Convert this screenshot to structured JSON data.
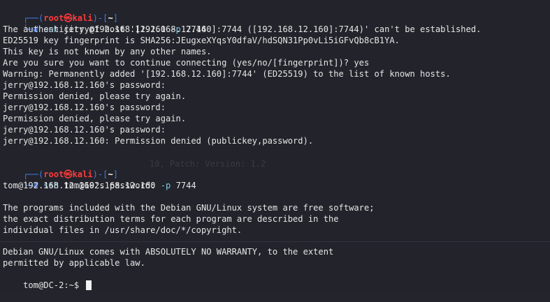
{
  "prompt1": {
    "bracket_open": "┌──(",
    "user": "root",
    "at_symbol": "㉿",
    "host": "kali",
    "bracket_mid": ")-[",
    "path": "~",
    "bracket_close": "]",
    "arrow": "└─",
    "hash": "#",
    "cmd": "ssh",
    "args": "jerry@192.168.12.160",
    "flag": "-p",
    "port": "7744"
  },
  "output1": [
    "The authenticity of host '[192.168.12.160]:7744 ([192.168.12.160]:7744)' can't be established.",
    "ED25519 key fingerprint is SHA256:JEugxeXYqsY0dfaV/hdSQN31Pp0vLi5iGFvQb8cB1YA.",
    "This key is not known by any other names.",
    "Are you sure you want to continue connecting (yes/no/[fingerprint])? yes",
    "Warning: Permanently added '[192.168.12.160]:7744' (ED25519) to the list of known hosts.",
    "jerry@192.168.12.160's password:",
    "Permission denied, please try again.",
    "jerry@192.168.12.160's password:",
    "Permission denied, please try again.",
    "jerry@192.168.12.160's password:",
    "jerry@192.168.12.160: Permission denied (publickey,password)."
  ],
  "prompt2": {
    "bracket_open": "┌──(",
    "user": "root",
    "at_symbol": "㉿",
    "host": "kali",
    "bracket_mid": ")-[",
    "path": "~",
    "bracket_close": "]",
    "arrow": "└─",
    "hash": "#",
    "cmd": "ssh",
    "args": "tom@192.168.12.160",
    "flag": "-p",
    "port": "7744"
  },
  "ghost_text": "10, Patch: Version: 1.2",
  "output2": [
    "tom@192.168.12.160's password:",
    "",
    "The programs included with the Debian GNU/Linux system are free software;",
    "the exact distribution terms for each program are described in the",
    "individual files in /usr/share/doc/*/copyright.",
    "",
    "Debian GNU/Linux comes with ABSOLUTELY NO WARRANTY, to the extent",
    "permitted by applicable law."
  ],
  "final_prompt": "tom@DC-2:~$ "
}
